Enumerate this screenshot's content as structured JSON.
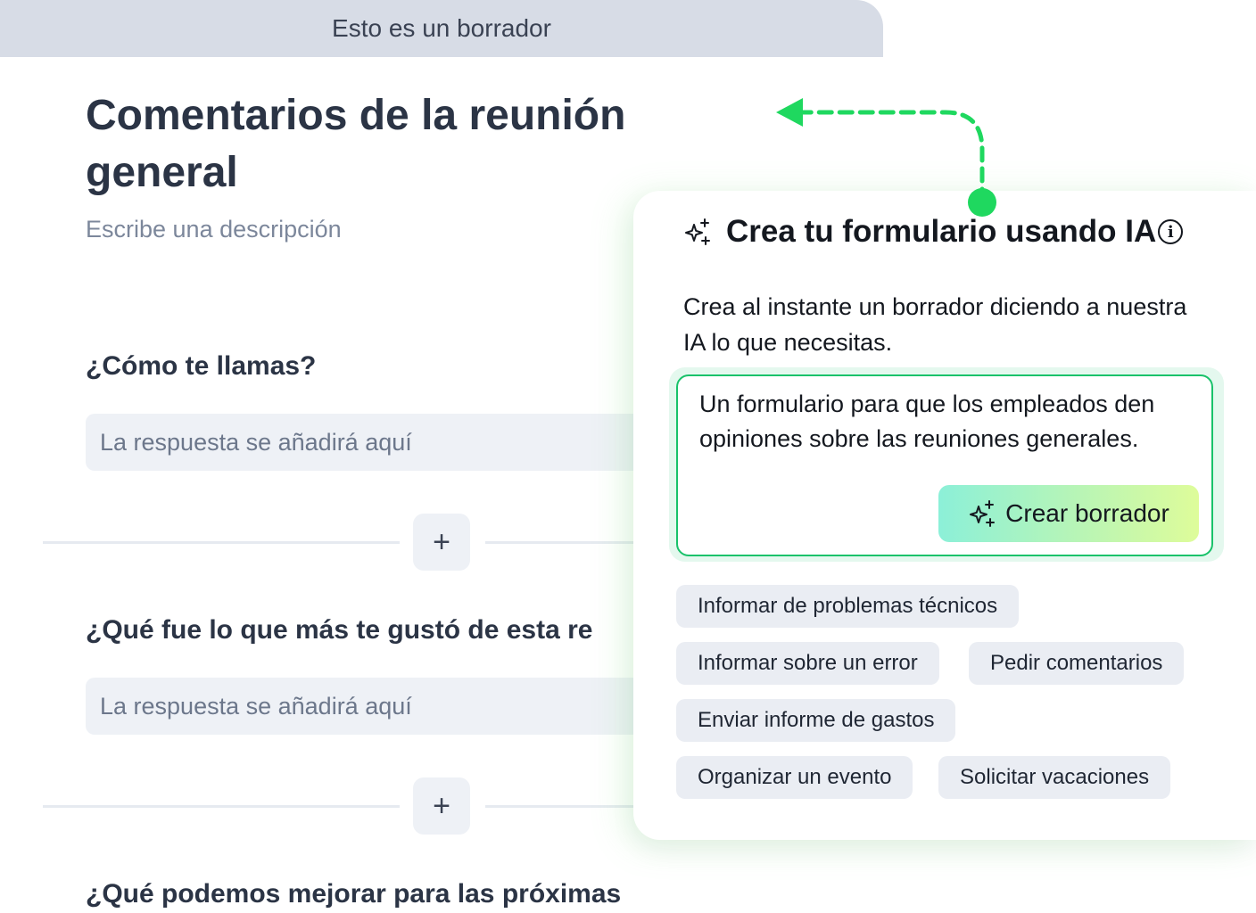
{
  "form": {
    "draft_banner": "Esto es un borrador",
    "title": "Comentarios de la reunión general",
    "description_placeholder": "Escribe una descripción",
    "questions": [
      {
        "label": "¿Cómo te llamas?",
        "answer_placeholder": "La respuesta se añadirá aquí"
      },
      {
        "label": "¿Qué fue lo que más te gustó de esta re",
        "answer_placeholder": "La respuesta se añadirá aquí"
      },
      {
        "label": "¿Qué podemos mejorar para las próximas"
      }
    ],
    "add_button_symbol": "+"
  },
  "ai_panel": {
    "title": "Crea tu formulario usando IA",
    "info_symbol": "i",
    "subtitle": "Crea al instante un borrador diciendo a nuestra IA lo que necesitas.",
    "prompt_text": "Un formulario para que los empleados den opiniones sobre las reuniones generales.",
    "create_button_label": "Crear borrador",
    "suggestions": [
      "Informar de problemas técnicos",
      "Informar sobre un error",
      "Pedir comentarios",
      "Enviar informe de gastos",
      "Organizar un evento",
      "Solicitar vacaciones"
    ]
  },
  "colors": {
    "accent_green": "#19c26a",
    "arrow_green": "#1fd85f",
    "draft_banner_bg": "#d7dce6"
  },
  "icons": {
    "ai": "sparkle-icon",
    "info": "info-icon",
    "add": "plus-icon",
    "pointer": "dashed-arrow-icon"
  }
}
